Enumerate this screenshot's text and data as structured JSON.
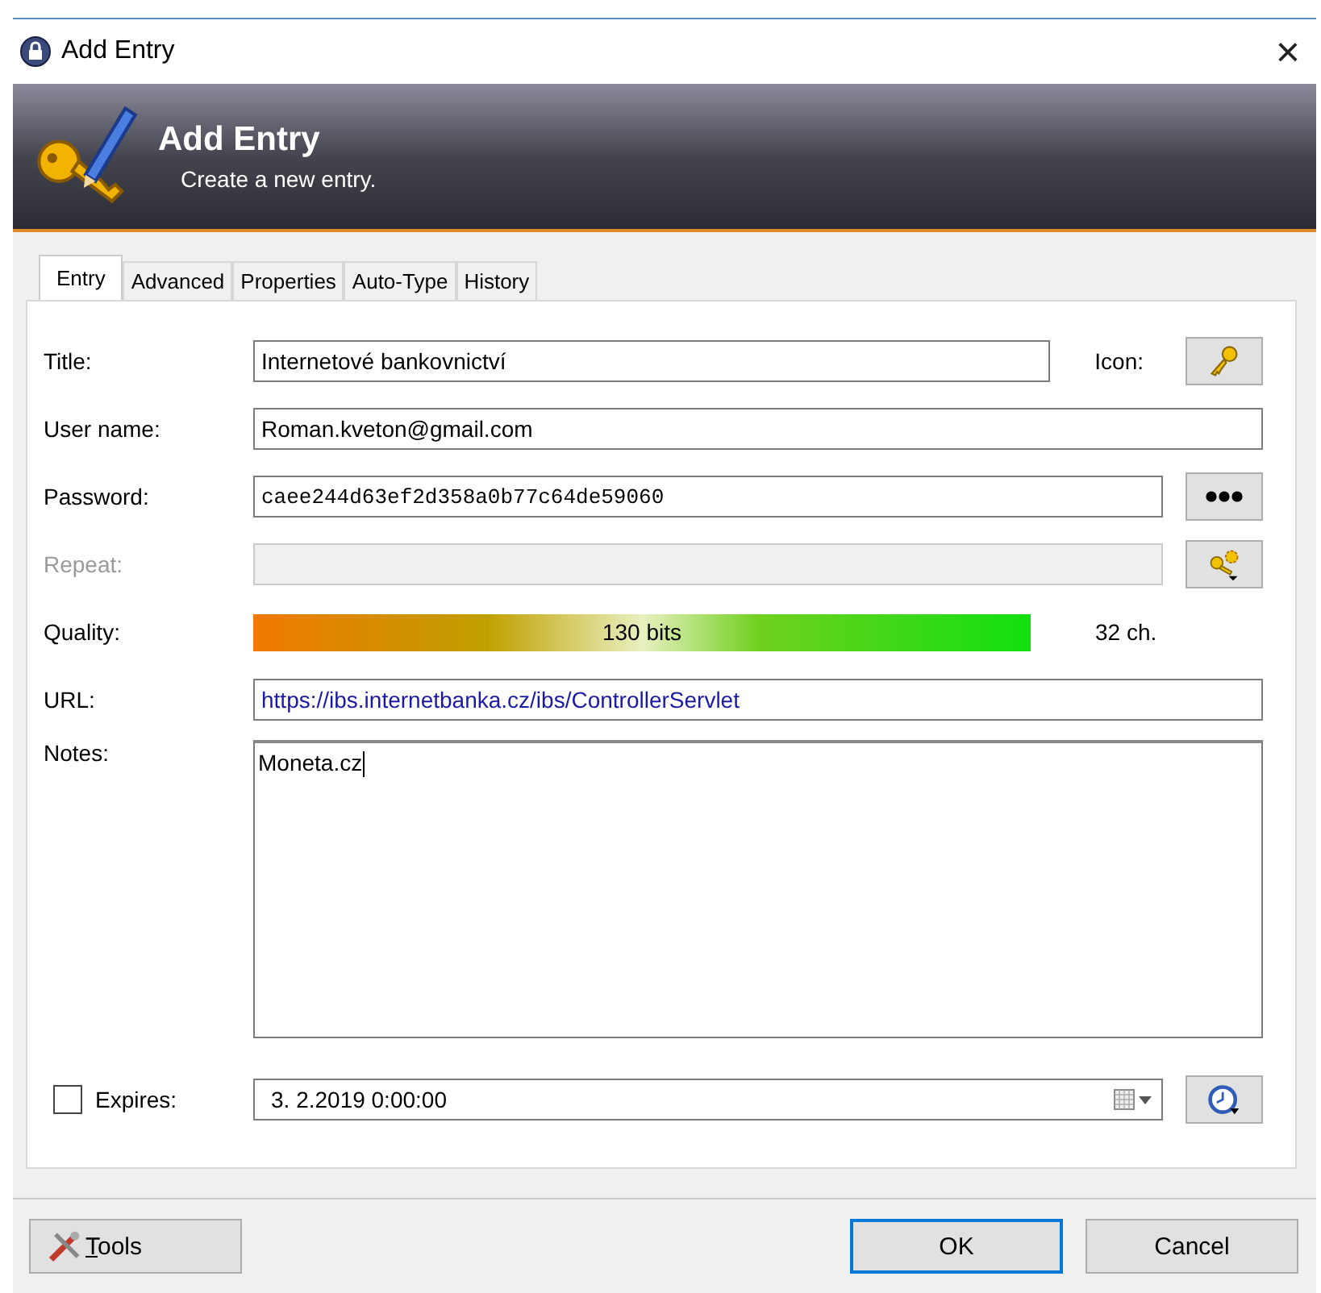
{
  "window": {
    "title": "Add Entry",
    "close": "×"
  },
  "banner": {
    "title": "Add Entry",
    "subtitle": "Create a new entry."
  },
  "tabs": [
    {
      "label": "Entry",
      "selected": true
    },
    {
      "label": "Advanced",
      "selected": false
    },
    {
      "label": "Properties",
      "selected": false
    },
    {
      "label": "Auto-Type",
      "selected": false
    },
    {
      "label": "History",
      "selected": false
    }
  ],
  "fields": {
    "title": {
      "label": "Title:",
      "value": "Internetové bankovnictví"
    },
    "icon_label": "Icon:",
    "username": {
      "label": "User name:",
      "value": "Roman.kveton@gmail.com"
    },
    "password": {
      "label": "Password:",
      "value": "caee244d63ef2d358a0b77c64de59060"
    },
    "repeat": {
      "label": "Repeat:",
      "disabled": true
    },
    "quality": {
      "label": "Quality:",
      "reading": "130 bits",
      "length": "32 ch."
    },
    "url": {
      "label": "URL:",
      "value": "https://ibs.internetbanka.cz/ibs/ControllerServlet"
    },
    "notes": {
      "label": "Notes:",
      "value": "Moneta.cz"
    },
    "expires": {
      "label": "Expires:",
      "checked": false,
      "value": "3.  2.2019   0:00:00"
    }
  },
  "buttons": [
    {
      "label": "Tools",
      "kind": "tools"
    },
    {
      "label": "OK",
      "kind": "default"
    },
    {
      "label": "Cancel",
      "kind": "plain"
    }
  ]
}
